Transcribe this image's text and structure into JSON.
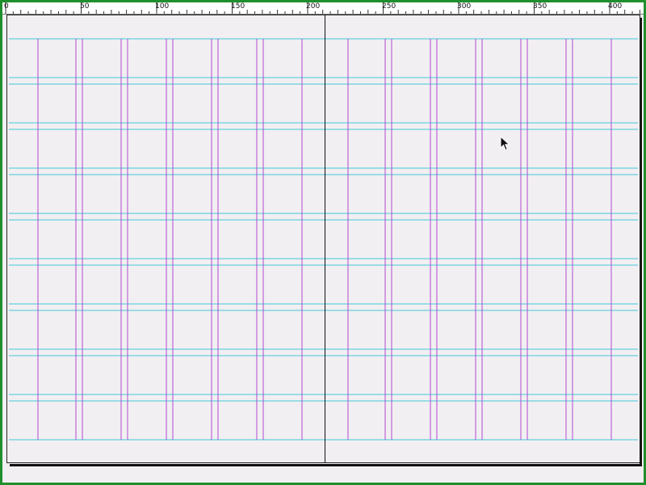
{
  "ruler": {
    "labels": [
      "0",
      "50",
      "100",
      "150",
      "200",
      "250",
      "300",
      "350",
      "400"
    ]
  },
  "colors": {
    "frame": "#1f8f2c",
    "column_guides": "#b04ad0",
    "row_guides": "#40c8d8",
    "page": "#f2eff2"
  },
  "cursor": {
    "icon": "arrow-cursor-icon"
  }
}
